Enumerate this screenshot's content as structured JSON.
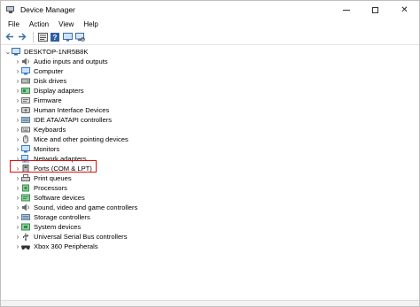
{
  "window": {
    "title": "Device Manager",
    "controls": {
      "minimize": "—",
      "maximize": "",
      "close": "✕"
    }
  },
  "menu": [
    "File",
    "Action",
    "View",
    "Help"
  ],
  "toolbar": {
    "buttons": [
      "back-arrow-icon",
      "forward-arrow-icon",
      "properties-icon",
      "help-icon",
      "scan-hardware-icon"
    ]
  },
  "tree": {
    "root": {
      "label": "DESKTOP-1NR5B8K",
      "expanded": true
    },
    "items": [
      {
        "label": "Audio inputs and outputs",
        "icon": "speaker-icon",
        "color": "#6b6b6b"
      },
      {
        "label": "Computer",
        "icon": "computer-icon",
        "color": "#3f7fc9"
      },
      {
        "label": "Disk drives",
        "icon": "disk-drive-icon",
        "color": "#7a7a7a"
      },
      {
        "label": "Display adapters",
        "icon": "display-adapter-icon",
        "color": "#4aa35a"
      },
      {
        "label": "Firmware",
        "icon": "firmware-icon",
        "color": "#8a8a8a"
      },
      {
        "label": "Human Interface Devices",
        "icon": "hid-icon",
        "color": "#6b6b6b"
      },
      {
        "label": "IDE ATA/ATAPI controllers",
        "icon": "ide-controller-icon",
        "color": "#5a7f9e"
      },
      {
        "label": "Keyboards",
        "icon": "keyboard-icon",
        "color": "#6b6b6b"
      },
      {
        "label": "Mice and other pointing devices",
        "icon": "mouse-icon",
        "color": "#6b6b6b"
      },
      {
        "label": "Monitors",
        "icon": "monitor-icon",
        "color": "#3f7fc9"
      },
      {
        "label": "Network adapters",
        "icon": "network-adapter-icon",
        "color": "#3f7fc9"
      },
      {
        "label": "Ports (COM & LPT)",
        "icon": "port-icon",
        "color": "#6b6b6b"
      },
      {
        "label": "Print queues",
        "icon": "printer-icon",
        "color": "#7a7a7a"
      },
      {
        "label": "Processors",
        "icon": "processor-icon",
        "color": "#4aa35a"
      },
      {
        "label": "Software devices",
        "icon": "software-device-icon",
        "color": "#4aa35a"
      },
      {
        "label": "Sound, video and game controllers",
        "icon": "sound-controller-icon",
        "color": "#6b6b6b"
      },
      {
        "label": "Storage controllers",
        "icon": "storage-controller-icon",
        "color": "#5a7f9e"
      },
      {
        "label": "System devices",
        "icon": "system-device-icon",
        "color": "#4aa35a"
      },
      {
        "label": "Universal Serial Bus controllers",
        "icon": "usb-icon",
        "color": "#6b6b6b"
      },
      {
        "label": "Xbox 360 Peripherals",
        "icon": "gamepad-icon",
        "color": "#333333"
      }
    ]
  },
  "highlight": {
    "item": "Ports (COM & LPT)",
    "color": "#dd1111"
  }
}
